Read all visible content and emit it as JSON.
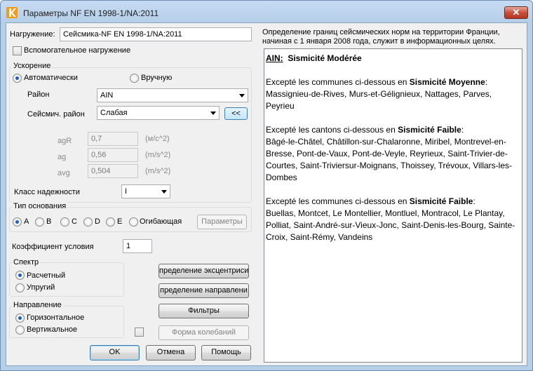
{
  "window": {
    "title": "Параметры NF EN 1998-1/NA:2011",
    "close_glyph": "✕"
  },
  "load": {
    "label": "Нагружение:",
    "value": "Сейсмика-NF EN 1998-1/NA:2011",
    "auxiliary_label": "Вспомогательное нагружение",
    "auxiliary_checked": false
  },
  "acceleration": {
    "title": "Ускорение",
    "auto_label": "Автоматически",
    "manual_label": "Вручную",
    "selected": "auto",
    "region_label": "Район",
    "region_value": "AIN",
    "seismic_zone_label": "Сейсмич. район",
    "seismic_zone_value": "Слабая",
    "collapse_label": "<<",
    "agR_label": "agR",
    "agR_value": "0,7",
    "agR_unit": "(м/с^2)",
    "ag_label": "ag",
    "ag_value": "0,56",
    "ag_unit": "(m/s^2)",
    "avg_label": "avg",
    "avg_value": "0,504",
    "avg_unit": "(m/s^2)"
  },
  "reliability": {
    "label": "Класс надежности",
    "value": "I"
  },
  "foundation": {
    "title": "Тип основания",
    "options": [
      "A",
      "B",
      "C",
      "D",
      "E",
      "Огибающая"
    ],
    "selected": "A",
    "params_label": "Параметры"
  },
  "condition": {
    "label": "Коэффициент условия",
    "value": "1"
  },
  "spectrum": {
    "title": "Спектр",
    "options": [
      "Расчетный",
      "Упругий"
    ],
    "selected": "Расчетный"
  },
  "direction": {
    "title": "Направление",
    "options": [
      "Горизонтальное",
      "Вертикальное"
    ],
    "selected": "Горизонтальное"
  },
  "actions": {
    "eccentricity": "пределение эксцентриситє",
    "direction_def": "пределение направлени",
    "filters": "Фильтры",
    "modes": "Форма колебаний",
    "modes_checked": false
  },
  "footer": {
    "ok": "OK",
    "cancel": "Отмена",
    "help": "Помощь"
  },
  "info": {
    "caption_line1": "Определение границ сейсмических норм на территории Франции,",
    "caption_line2": "начиная с 1 января 2008 года, служит в информационных целях.",
    "header_code": "AIN:",
    "header_text": "Sismicité Modérée",
    "p1_intro": "Excepté les communes ci-dessous en ",
    "p1_level": "Sismicité Moyenne",
    "p1_colon": ":",
    "p1_list": "Massignieu-de-Rives, Murs-et-Gélignieux, Nattages, Parves, Peyrieu",
    "p2_intro": "Excepté les cantons ci-dessous en ",
    "p2_level": "Sismicité Faible",
    "p2_colon": ":",
    "p2_list": "Bâgé-le-Châtel, Châtillon-sur-Chalaronne, Miribel, Montrevel-en-Bresse, Pont-de-Vaux, Pont-de-Veyle, Reyrieux, Saint-Trivier-de-Courtes, Saint-Triviersur-Moignans, Thoissey, Trévoux, Villars-les-Dombes",
    "p3_intro": "Excepté les communes ci-dessous en ",
    "p3_level": "Sismicité Faible",
    "p3_colon": ":",
    "p3_list": "Buellas, Montcet, Le Montellier, Montluel, Montracol, Le Plantay, Polliat, Saint-André-sur-Vieux-Jonc, Saint-Denis-les-Bourg, Sainte-Croix, Saint-Rémy, Vandeins"
  },
  "icons": {
    "app": "app-logo-icon",
    "dropdown": "chevron-down-icon"
  },
  "colors": {
    "accent": "#1f5fb5",
    "title_bar": "#b6cfe9",
    "close": "#c94f3a"
  }
}
